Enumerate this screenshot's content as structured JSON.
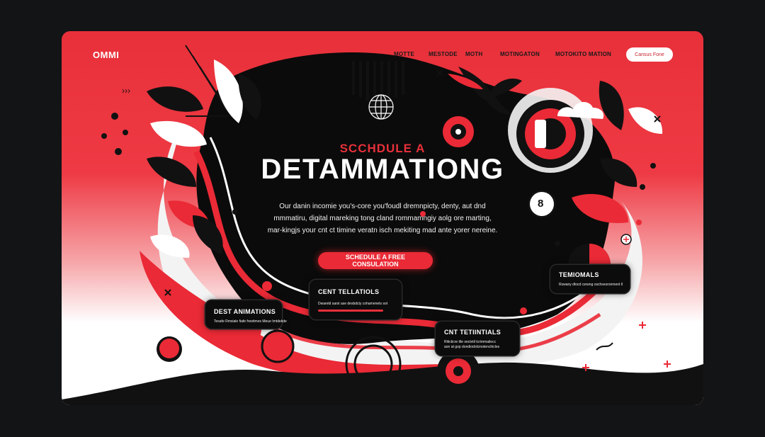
{
  "brand": {
    "logo": "OMMI"
  },
  "nav": {
    "links": [
      "MOTTE",
      "MESTODE",
      "MOTH",
      "MOTINGATON",
      "MOTOKITO MATION"
    ],
    "button": "Cansus Fone"
  },
  "hero": {
    "subtitle": "SCCHDULE A",
    "title": "DETAMMATIONG",
    "body": [
      "Our  danin  incomie  you's-core you'foudl dremnpicty,  denty,  aut  dnd",
      "mmmatiru,  digital  mareking  tong cland  rommamngiy  aolg ore  marting,",
      "mar-kingjs  your cnt ct timine  veratn  isch  mekiting  mad ante yorer  nereine."
    ],
    "cta": "SCHEDULE A FREE CONSULATION"
  },
  "cards": {
    "left": {
      "title": "DEST ANIMATIONS",
      "text": "Tesafe  Rmxiale  fiafe  freetimes  Meue  Imtdekde"
    },
    "center": {
      "title": "CENT TELLATIOLS",
      "text": "Dwareld  sarst  ase  desbdcty  cohamenets  sot"
    },
    "right": {
      "title": "TEMIOMALS",
      "text": "Rswany  dlocd  csrwng  oschsesronment  ll"
    },
    "bottom": {
      "title": "CNT TETIINTIALS",
      "text": [
        "Riticticre  tile  oectvtil  tcrimmailecc",
        "aon  at  gop  dondiodolcinotenchicles"
      ]
    }
  },
  "badge": {
    "number": "8"
  },
  "colors": {
    "accent": "#e8303a",
    "dark": "#0c0c0c",
    "light": "#ffffff",
    "backdrop": "#121416"
  }
}
